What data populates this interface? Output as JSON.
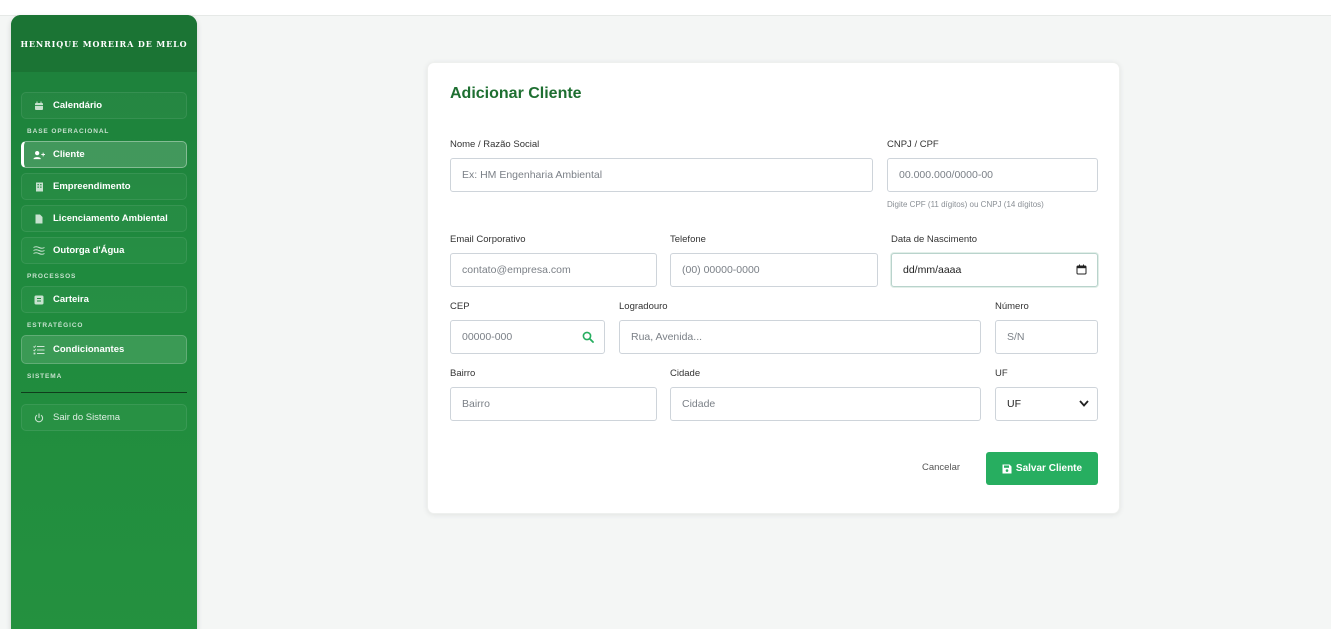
{
  "sidebar": {
    "brand": "HENRIQUE MOREIRA DE MELO",
    "calendar": {
      "label": "Calendário",
      "icon": "calendar-icon"
    },
    "sections": {
      "base": "BASE OPERACIONAL",
      "processos": "PROCESSOS",
      "estrategico": "ESTRATÉGICO",
      "sistema": "SISTEMA"
    },
    "items": {
      "cliente": {
        "label": "Cliente",
        "icon": "user-plus-icon",
        "active": true
      },
      "empreendimento": {
        "label": "Empreendimento",
        "icon": "building-icon"
      },
      "licenciamento": {
        "label": "Licenciamento Ambiental",
        "icon": "file-icon"
      },
      "outorga": {
        "label": "Outorga d'Água",
        "icon": "water-icon"
      },
      "carteira": {
        "label": "Carteira",
        "icon": "wallet-icon"
      },
      "condicionantes": {
        "label": "Condicionantes",
        "icon": "list-check-icon"
      }
    },
    "logout": {
      "label": "Sair do Sistema",
      "icon": "power-icon"
    }
  },
  "form": {
    "title": "Adicionar Cliente",
    "nome": {
      "label": "Nome / Razão Social",
      "placeholder": "Ex: HM Engenharia Ambiental"
    },
    "cnpj": {
      "label": "CNPJ / CPF",
      "placeholder": "00.000.000/0000-00",
      "hint": "Digite CPF (11 dígitos) ou CNPJ (14 dígitos)"
    },
    "email": {
      "label": "Email Corporativo",
      "placeholder": "contato@empresa.com"
    },
    "telefone": {
      "label": "Telefone",
      "placeholder": "(00) 00000-0000"
    },
    "nascimento": {
      "label": "Data de Nascimento",
      "value": "dd/mm/aaaa"
    },
    "cep": {
      "label": "CEP",
      "placeholder": "00000-000"
    },
    "logradouro": {
      "label": "Logradouro",
      "placeholder": "Rua, Avenida..."
    },
    "numero": {
      "label": "Número",
      "placeholder": "S/N"
    },
    "bairro": {
      "label": "Bairro",
      "placeholder": "Bairro"
    },
    "cidade": {
      "label": "Cidade",
      "placeholder": "Cidade"
    },
    "uf": {
      "label": "UF",
      "value": "UF"
    },
    "cancel": "Cancelar",
    "save": "Salvar Cliente"
  },
  "colors": {
    "brand_green": "#1f8a3e",
    "title_green": "#1e6f31",
    "save_green": "#27ae60"
  }
}
